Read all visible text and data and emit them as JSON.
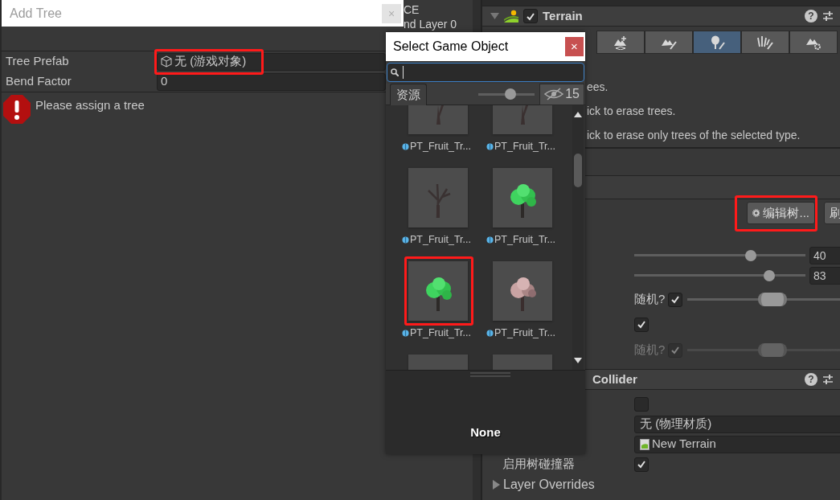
{
  "hierarchy": {
    "items": [
      "CE",
      "nd Layer 0"
    ]
  },
  "inspector": {
    "terrain": {
      "title": "Terrain",
      "expanded": true,
      "enabled": true,
      "help": "?",
      "tools": [
        {
          "kind": "raise",
          "selected": false
        },
        {
          "kind": "paint",
          "selected": false
        },
        {
          "kind": "trees",
          "selected": true
        },
        {
          "kind": "details",
          "selected": false
        },
        {
          "kind": "settings",
          "selected": false
        }
      ],
      "help_lines": [
        "ees.",
        "ick to erase trees.",
        "ick to erase only trees of the selected type."
      ],
      "buttons": [
        {
          "kind": "gear",
          "label": "编辑树...",
          "highlighted": true
        },
        {
          "kind": "plain",
          "label": "刷",
          "highlighted": false
        }
      ],
      "sliders": [
        {
          "level": 0.68,
          "value": "40"
        },
        {
          "level": 0.79,
          "value": "83"
        }
      ],
      "options": [
        {
          "kind": "range",
          "label": "随机?",
          "checked": true,
          "disabled": false,
          "level": 0.56
        },
        {
          "kind": "check",
          "checked": true,
          "disabled": false
        },
        {
          "kind": "range",
          "label": "随机?",
          "checked": true,
          "disabled": true,
          "level": 0.56
        }
      ]
    },
    "collider": {
      "title": "Collider",
      "help": "?",
      "rows": [
        {
          "kind": "checkbox",
          "checked": false
        },
        {
          "kind": "object",
          "value": "无 (物理材质)"
        },
        {
          "kind": "asset",
          "value": "New Terrain"
        },
        {
          "kind": "checkbox",
          "label": "启用树碰撞器",
          "checked": true
        }
      ],
      "layer_overrides": {
        "label": "Layer Overrides",
        "expanded": false
      }
    }
  },
  "add_tree_window": {
    "title": "Add Tree",
    "close": "×",
    "fields": [
      {
        "label": "Tree Prefab",
        "kind": "object",
        "value": "无 (游戏对象)",
        "highlighted": true
      },
      {
        "label": "Bend Factor",
        "kind": "number",
        "value": "0",
        "highlighted": false
      }
    ],
    "error": "Please assign a tree"
  },
  "select_window": {
    "title": "Select Game Object",
    "close": "×",
    "tab": "资源",
    "size_slider": {
      "level": 0.57
    },
    "hidden_count": "15",
    "assets": [
      {
        "label": "PT_Fruit_Tr...",
        "kind": "trunk",
        "highlighted": false
      },
      {
        "label": "PT_Fruit_Tr...",
        "kind": "trunk",
        "highlighted": false
      },
      {
        "label": "PT_Fruit_Tr...",
        "kind": "bare",
        "highlighted": false
      },
      {
        "label": "PT_Fruit_Tr...",
        "kind": "green",
        "highlighted": false
      },
      {
        "label": "PT_Fruit_Tr...",
        "kind": "green",
        "highlighted": true
      },
      {
        "label": "PT_Fruit_Tr...",
        "kind": "pink",
        "highlighted": false
      },
      {
        "kind": "empty",
        "highlighted": false
      },
      {
        "kind": "empty",
        "highlighted": false
      }
    ],
    "preview_label": "None"
  }
}
